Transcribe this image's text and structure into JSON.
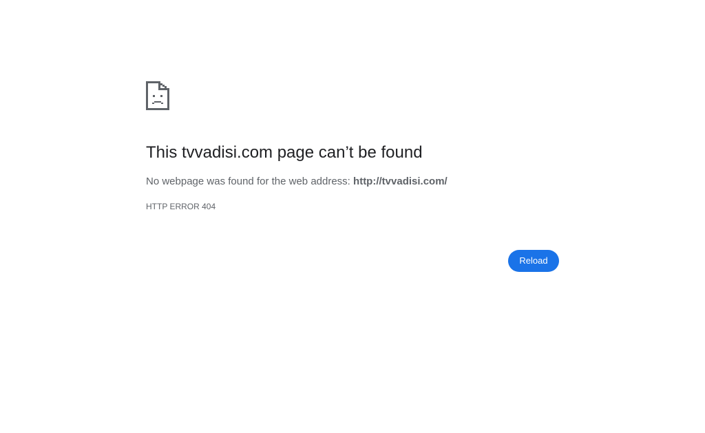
{
  "error_page": {
    "icon": "sad-document-icon",
    "title": "This tvvadisi.com page can’t be found",
    "summary_prefix": "No webpage was found for the web address: ",
    "summary_url": "http://tvvadisi.com/",
    "error_code": "HTTP ERROR 404",
    "reload_label": "Reload"
  },
  "colors": {
    "background": "#ffffff",
    "title": "#202124",
    "body_text": "#5f6368",
    "button_bg": "#1a73e8",
    "button_text": "#ffffff",
    "icon": "#5f6368"
  }
}
